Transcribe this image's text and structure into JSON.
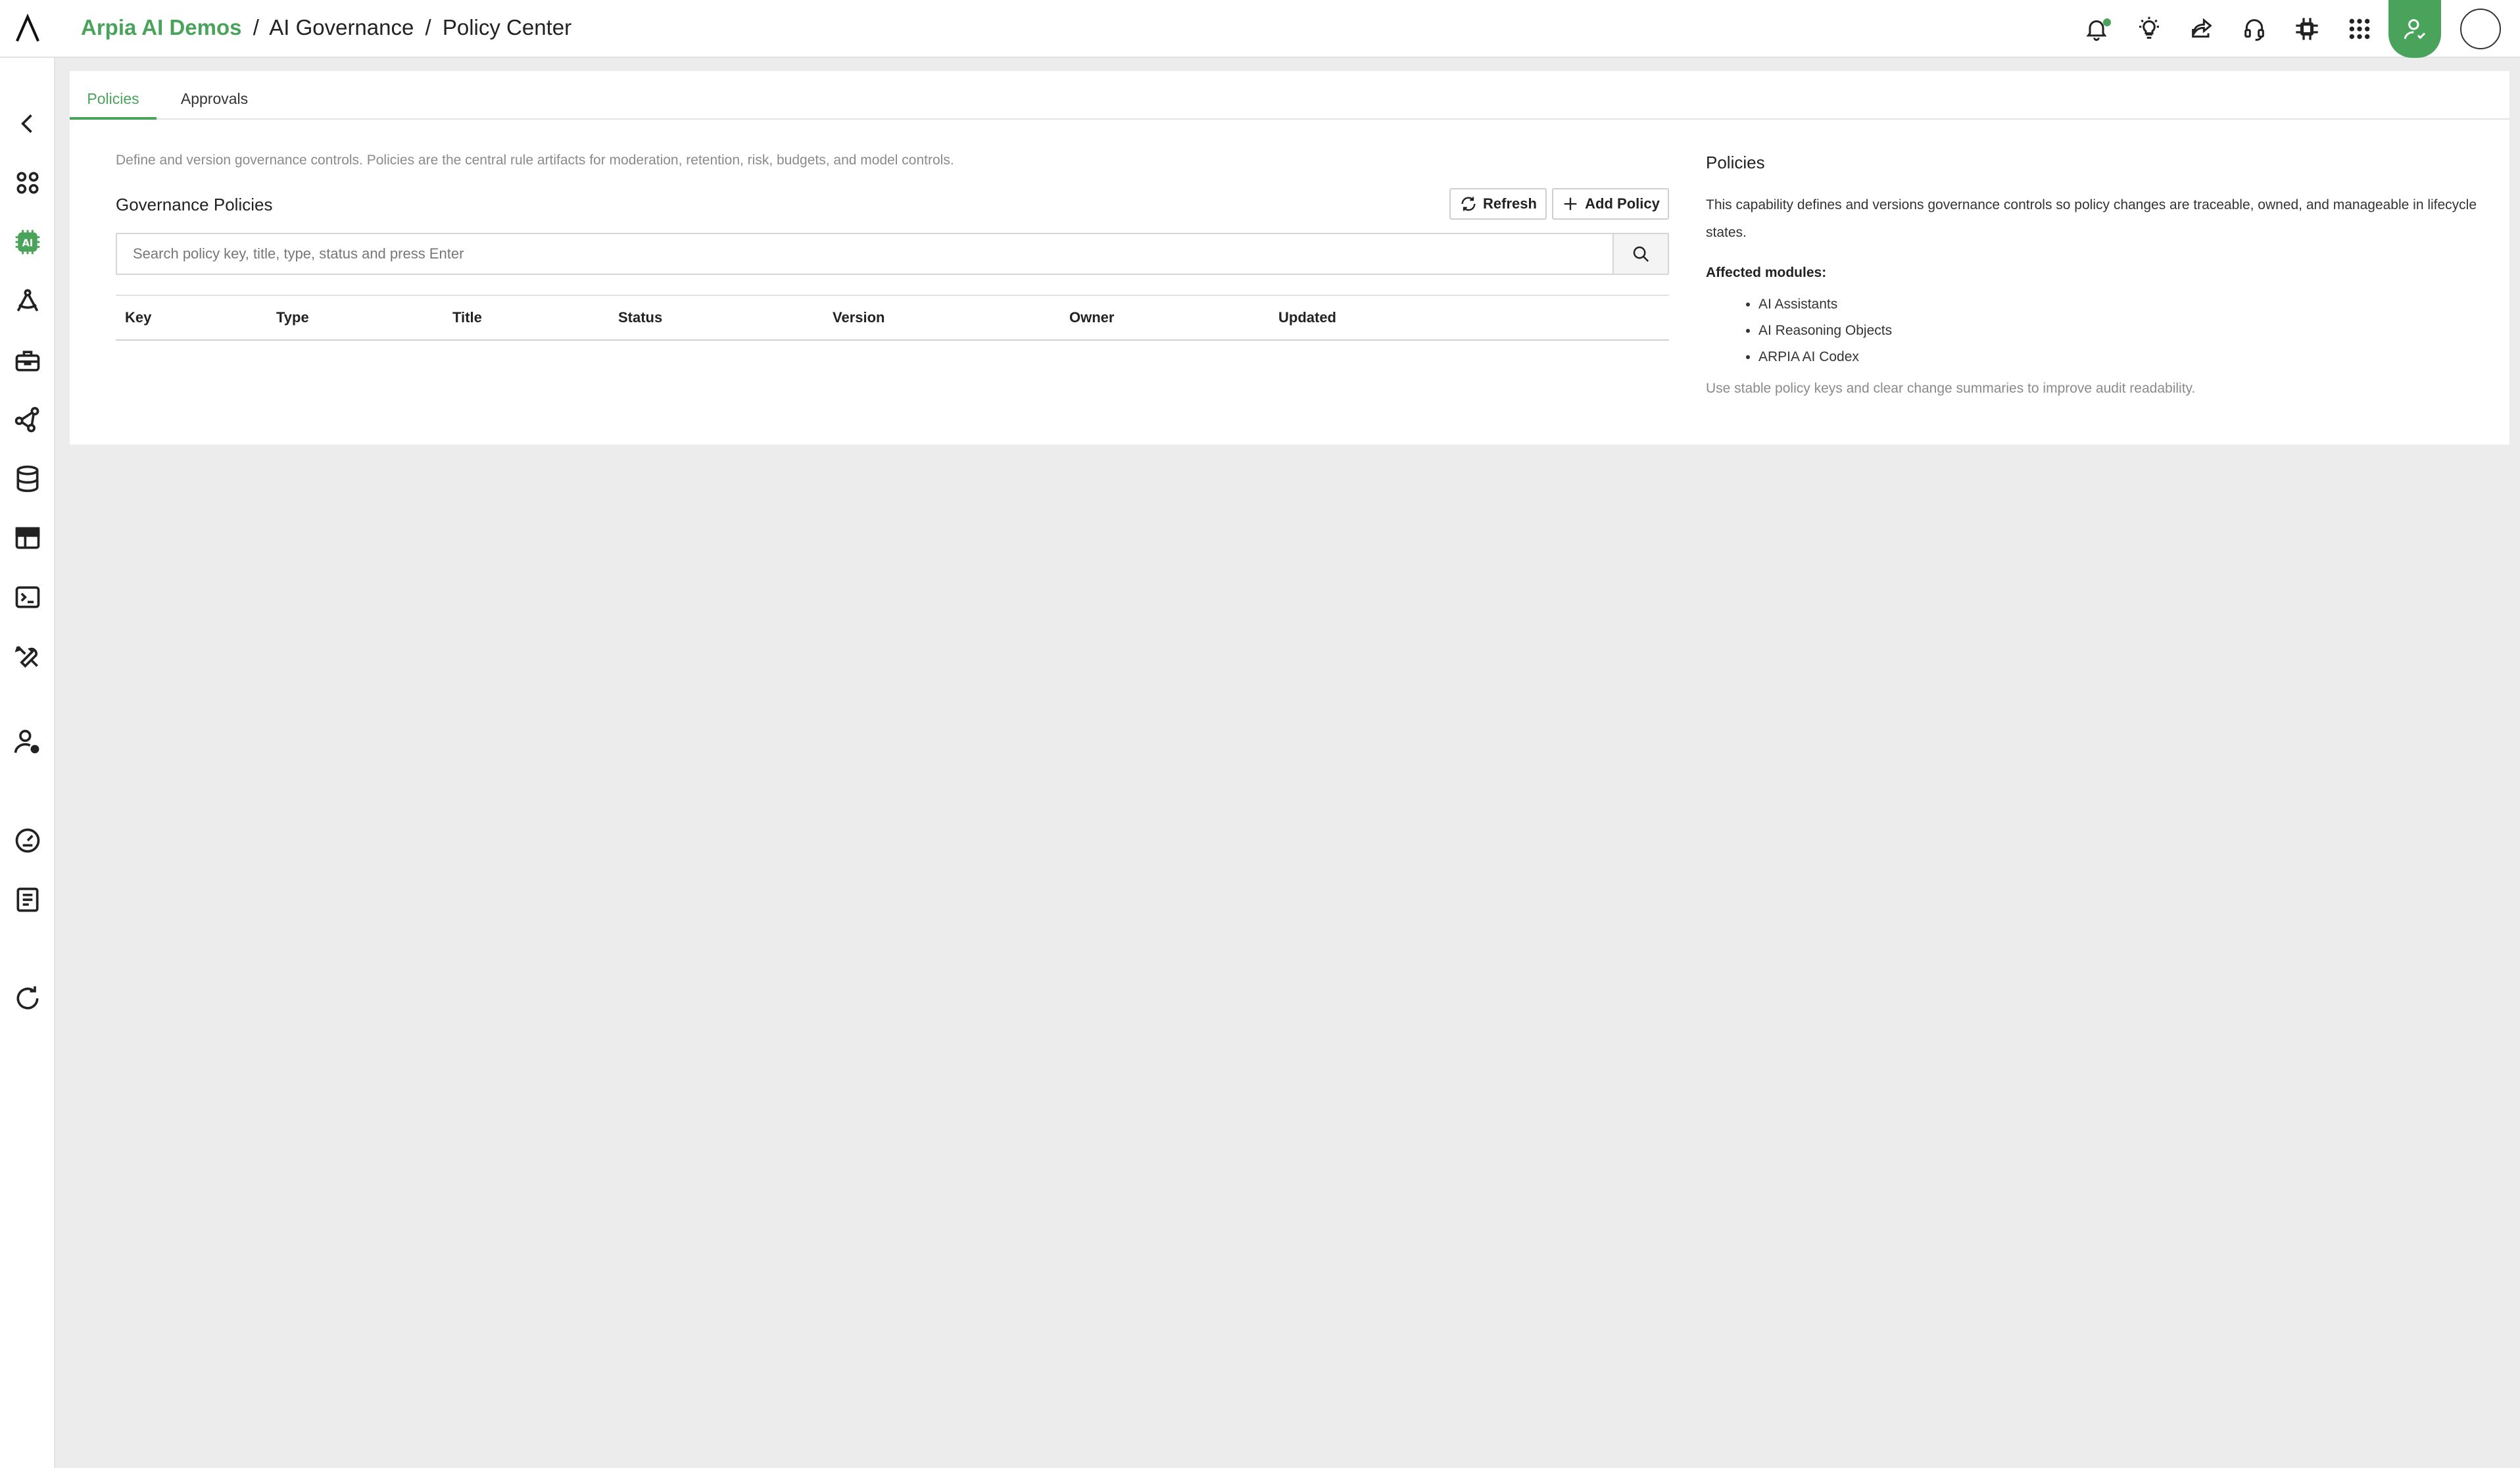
{
  "header": {
    "org": "Arpia AI Demos",
    "crumbs": [
      "AI Governance",
      "Policy Center"
    ],
    "separator": "/"
  },
  "icons": {
    "logo": "lambda-logo-icon",
    "top": [
      "bell-icon",
      "lightbulb-icon",
      "share-icon",
      "headset-icon",
      "chip-icon",
      "apps-grid-icon",
      "user-admin-icon",
      "avatar"
    ],
    "sidebar": [
      "chevron-left-icon",
      "modules-icon",
      "ai-icon",
      "drafting-compass-icon",
      "toolbox-icon",
      "nodes-icon",
      "database-icon",
      "table-icon",
      "terminal-icon",
      "tools-icon",
      "user-settings-icon",
      "gauge-icon",
      "book-icon",
      "refresh-icon"
    ]
  },
  "colors": {
    "accent": "#4aa35a",
    "background": "#ececec"
  },
  "tabs": [
    {
      "label": "Policies",
      "active": true
    },
    {
      "label": "Approvals",
      "active": false
    }
  ],
  "main": {
    "description": "Define and version governance controls. Policies are the central rule artifacts for moderation, retention, risk, budgets, and model controls.",
    "title": "Governance Policies",
    "refresh_label": "Refresh",
    "add_label": "Add Policy",
    "search_placeholder": "Search policy key, title, type, status and press Enter",
    "columns": [
      "Key",
      "Type",
      "Title",
      "Status",
      "Version",
      "Owner",
      "Updated"
    ],
    "rows": []
  },
  "info": {
    "title": "Policies",
    "text": "This capability defines and versions governance controls so policy changes are traceable, owned, and manageable in lifecycle states.",
    "affected_label": "Affected modules:",
    "modules": [
      "AI Assistants",
      "AI Reasoning Objects",
      "ARPIA AI Codex"
    ],
    "footer": "Use stable policy keys and clear change summaries to improve audit readability."
  }
}
